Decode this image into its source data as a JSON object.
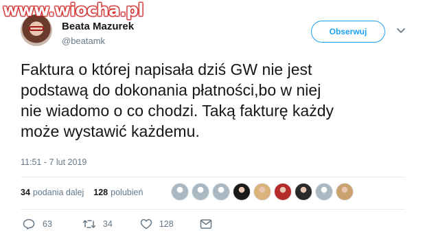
{
  "watermark": "www.wiocha.pl",
  "author": {
    "name": "Beata Mazurek",
    "handle": "@beatamk"
  },
  "follow_button": "Obserwuj",
  "tweet": {
    "text": "Faktura o której napisała dziś GW  nie jest\npodstawą do dokonania płatności,bo w niej\nnie wiadomo o co chodzi. Taką fakturę każdy\nmoże wystawić każdemu.",
    "timestamp": "11:51 - 7 lut 2019"
  },
  "stats": {
    "retweets_count": "34",
    "retweets_label": "podania dalej",
    "likes_count": "128",
    "likes_label": "polubień"
  },
  "liker_avatars": [
    {
      "color": "#aab8c2"
    },
    {
      "color": "#aab8c2"
    },
    {
      "color": "#aab8c2"
    },
    {
      "color": "#1a1a1a"
    },
    {
      "color": "#d9b27c"
    },
    {
      "color": "#b52a2a"
    },
    {
      "color": "#2a2a2a"
    },
    {
      "color": "#aab8c2"
    },
    {
      "color": "#c9a26e"
    }
  ],
  "actions": {
    "replies": "63",
    "retweets": "34",
    "likes": "128"
  },
  "colors": {
    "accent": "#1da1f2",
    "secondary_text": "#657786",
    "divider": "#e6ecf0"
  },
  "icons": [
    "reply-icon",
    "retweet-icon",
    "heart-icon",
    "direct-message-icon",
    "chevron-down-icon"
  ]
}
